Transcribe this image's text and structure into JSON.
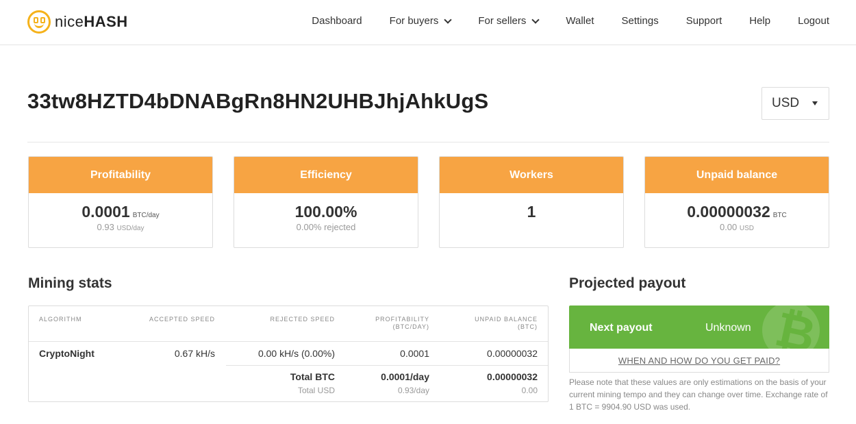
{
  "brand": {
    "name_thin": "nice",
    "name_bold": "HASH"
  },
  "nav": {
    "items": [
      {
        "label": "Dashboard"
      },
      {
        "label": "For buyers",
        "dropdown": true
      },
      {
        "label": "For sellers",
        "dropdown": true
      },
      {
        "label": "Wallet"
      },
      {
        "label": "Settings"
      },
      {
        "label": "Support"
      },
      {
        "label": "Help"
      },
      {
        "label": "Logout"
      }
    ]
  },
  "address": "33tw8HZTD4bDNABgRn8HN2UHBJhjAhkUgS",
  "currency_select": {
    "value": "USD"
  },
  "cards": [
    {
      "title": "Profitability",
      "main": "0.0001",
      "unit": "BTC/day",
      "sub": "0.93",
      "sub_unit": "USD/day"
    },
    {
      "title": "Efficiency",
      "main": "100.00%",
      "sub": "0.00% rejected"
    },
    {
      "title": "Workers",
      "main": "1"
    },
    {
      "title": "Unpaid balance",
      "main": "0.00000032",
      "unit": "BTC",
      "sub": "0.00",
      "sub_unit": "USD"
    }
  ],
  "mining_stats": {
    "title": "Mining stats",
    "columns": {
      "algorithm": "ALGORITHM",
      "accepted": "ACCEPTED SPEED",
      "rejected": "REJECTED SPEED",
      "profitability_1": "PROFITABILITY",
      "profitability_2": "(BTC/DAY)",
      "unpaid_1": "UNPAID BALANCE",
      "unpaid_2": "(BTC)"
    },
    "row": {
      "algorithm": "CryptoNight",
      "accepted": "0.67 kH/s",
      "rejected": "0.00 kH/s (0.00%)",
      "profitability": "0.0001",
      "unpaid": "0.00000032"
    },
    "totals": {
      "btc_label": "Total BTC",
      "btc_profit": "0.0001/day",
      "btc_unpaid": "0.00000032",
      "usd_label": "Total USD",
      "usd_profit": "0.93/day",
      "usd_unpaid": "0.00"
    }
  },
  "payout": {
    "title": "Projected payout",
    "label": "Next payout",
    "value": "Unknown",
    "link": "WHEN AND HOW DO YOU GET PAID?",
    "note": "Please note that these values are only estimations on the basis of your current mining tempo and they can change over time. Exchange rate of 1 BTC = 9904.90 USD was used."
  },
  "colors": {
    "card_header": "#f7a443",
    "payout_green": "#67b43f",
    "logo_yellow": "#f5b21b"
  }
}
